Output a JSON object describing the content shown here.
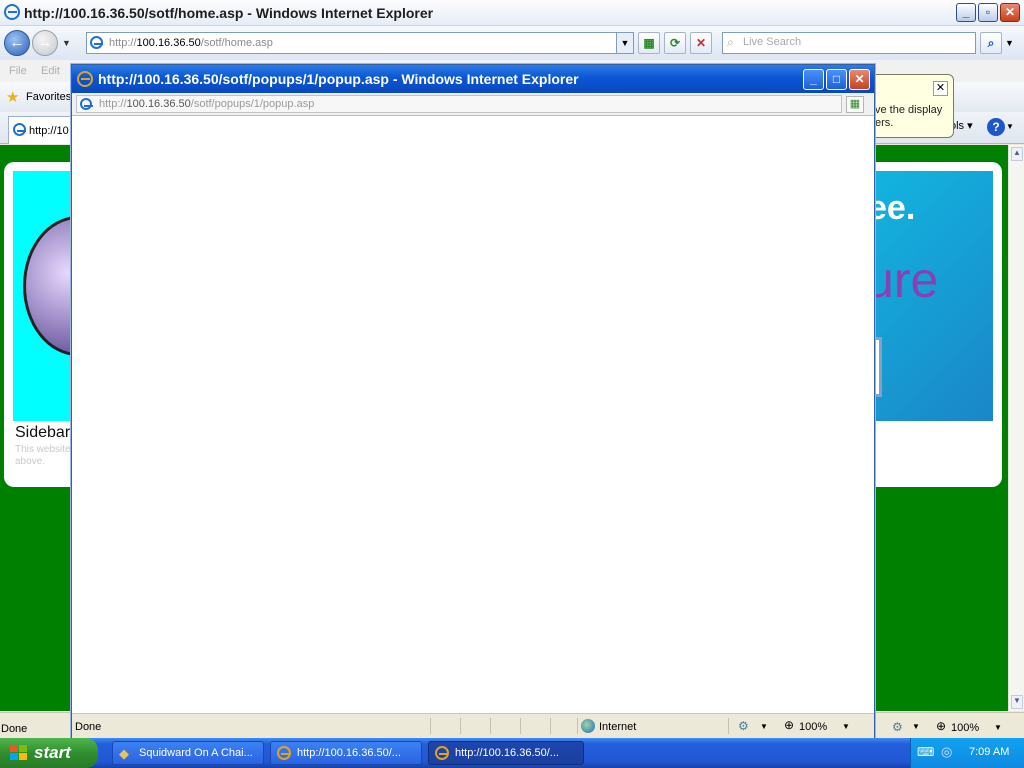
{
  "main_window": {
    "title": "http://100.16.36.50/sotf/home.asp - Windows Internet Explorer",
    "address": {
      "scheme": "http://",
      "host": "100.16.36.50",
      "path": "/sotf/home.asp"
    },
    "search_placeholder": "Live Search",
    "menu": [
      "File",
      "Edit"
    ],
    "favorites_label": "Favorites",
    "tab_label": "http://10",
    "tools_label": "ols",
    "info_bar_text": "ve the display\ners.",
    "page": {
      "banner_right_line1": "ee.",
      "banner_right_line2": "ure",
      "sidebar_heading": "Sidebar:",
      "sidebar_text": "This website\nabove."
    },
    "status": {
      "text": "Done",
      "zoom": "100%"
    }
  },
  "popup": {
    "title": "http://100.16.36.50/sotf/popups/1/popup.asp - Windows Internet Explorer",
    "address": {
      "scheme": "http://",
      "host": "100.16.36.50",
      "path": "/sotf/popups/1/popup.asp"
    },
    "status": {
      "text": "Done",
      "zone": "Internet",
      "zoom": "100%"
    }
  },
  "taskbar": {
    "start_label": "start",
    "tasks": [
      {
        "label": "Squidward On A Chai..."
      },
      {
        "label": "http://100.16.36.50/..."
      },
      {
        "label": "http://100.16.36.50/..."
      }
    ],
    "clock": "7:09 AM"
  },
  "colors": {
    "page_bg": "#008000",
    "xp_blue": "#0b56d4",
    "start_green": "#308d2e"
  }
}
